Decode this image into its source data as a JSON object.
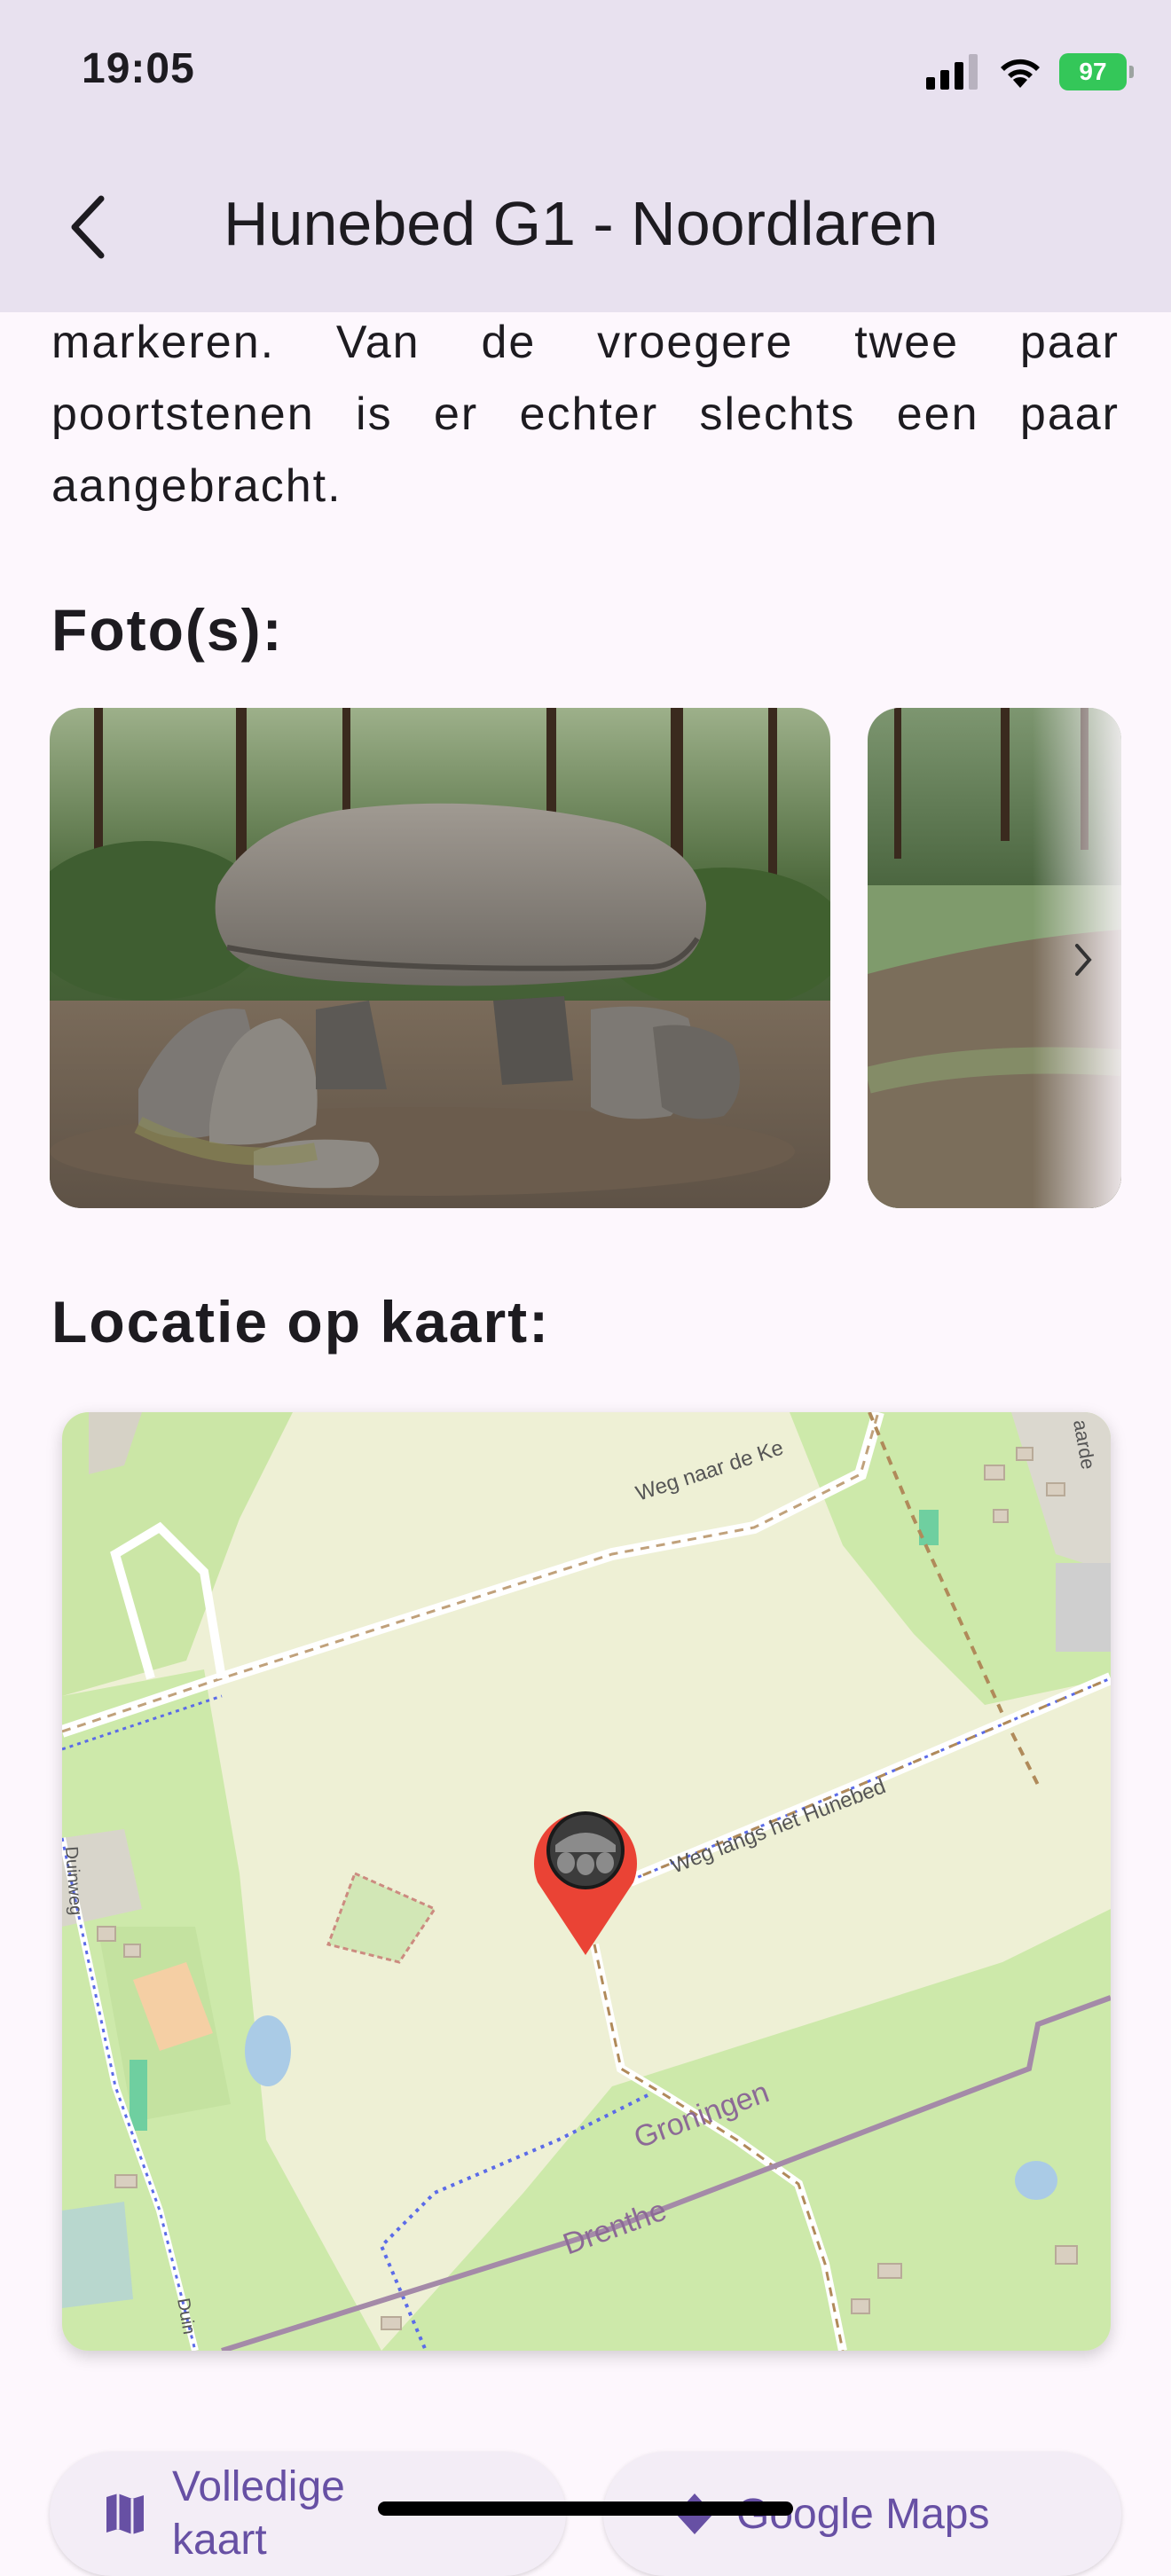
{
  "status": {
    "time": "19:05",
    "battery": "97"
  },
  "header": {
    "title": "Hunebed G1 - Noordlaren"
  },
  "description_lines": [
    "markeren. Van de vroegere twee paar",
    "poortstenen is er echter slechts een paar",
    "aangebracht."
  ],
  "sections": {
    "photos": "Foto(s):",
    "map": "Locatie op kaart:"
  },
  "map_labels": {
    "road_top": "Weg naar de Ke",
    "road_side_top": "aarde",
    "road_hunebed": "Weg langs het Hunebed",
    "province_north": "Groningen",
    "province_south": "Drenthe",
    "road_left": "Duinweg",
    "road_left_bottom": "Duin"
  },
  "buttons": {
    "full_map": "Volledige kaart",
    "google_maps": "Google Maps"
  },
  "colors": {
    "appbar": "#e8e1ef",
    "background": "#fdf7fd",
    "accent": "#6750a4",
    "marker": "#ea4335"
  }
}
